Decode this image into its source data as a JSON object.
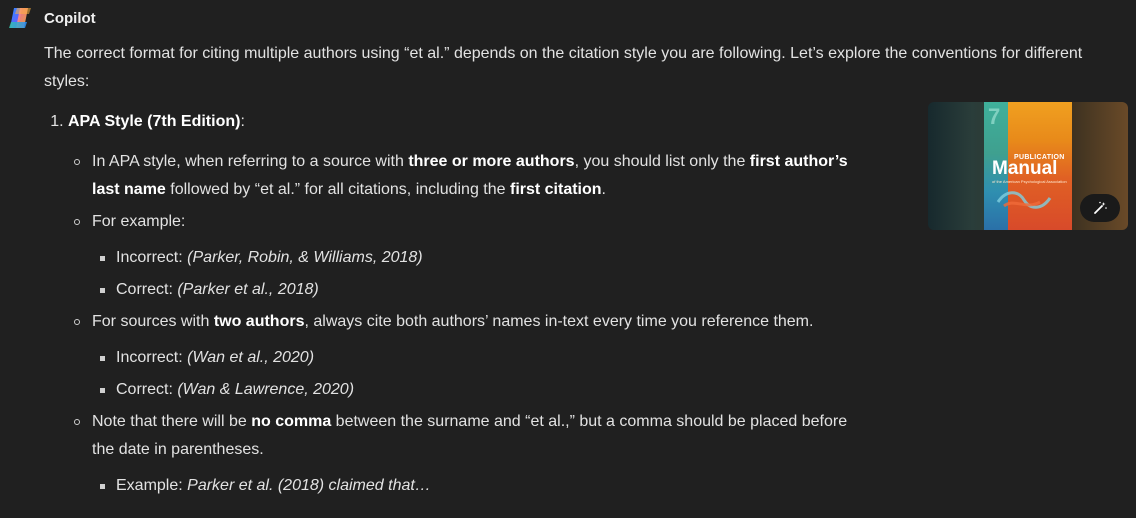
{
  "app": {
    "name": "Copilot"
  },
  "message": {
    "intro": "The correct format for citing multiple authors using “et al.” depends on the citation style you are following. Let’s explore the conventions for different styles:",
    "section1": {
      "title": "APA Style (7th Edition)",
      "suffix": ":",
      "p1": {
        "t1": "In APA style, when referring to a source with ",
        "b1": "three or more authors",
        "t2": ", you should list only the ",
        "b2": "first author’s last name",
        "t3": " followed by “et al.” for all citations, including the ",
        "b3": "first citation",
        "t4": "."
      },
      "p2": {
        "text": "For example:",
        "sub": [
          {
            "label": "Incorrect: ",
            "example": "(Parker, Robin, & Williams, 2018)"
          },
          {
            "label": "Correct: ",
            "example": "(Parker et al., 2018)"
          }
        ]
      },
      "p3": {
        "t1": "For sources with ",
        "b1": "two authors",
        "t2": ", always cite both authors’ names in-text every time you reference them.",
        "sub": [
          {
            "label": "Incorrect: ",
            "example": "(Wan et al., 2020)"
          },
          {
            "label": "Correct: ",
            "example": "(Wan & Lawrence, 2020)"
          }
        ]
      },
      "p4": {
        "t1": "Note that there will be ",
        "b1": "no comma",
        "t2": " between the surname and “et al.,” but a comma should be placed before the date in parentheses.",
        "sub": [
          {
            "label": "Example: ",
            "example": "Parker et al. (2018) claimed that…"
          }
        ]
      }
    }
  },
  "thumbnail": {
    "cover_number": "7",
    "cover_kicker": "PUBLICATION",
    "cover_title": "Manual",
    "cover_subtitle": "of the American Psychological Association",
    "action_icon": "magic-wand-icon"
  },
  "colors": {
    "background": "#202020",
    "text": "#e2e2e2",
    "bold_text": "#ffffff"
  }
}
